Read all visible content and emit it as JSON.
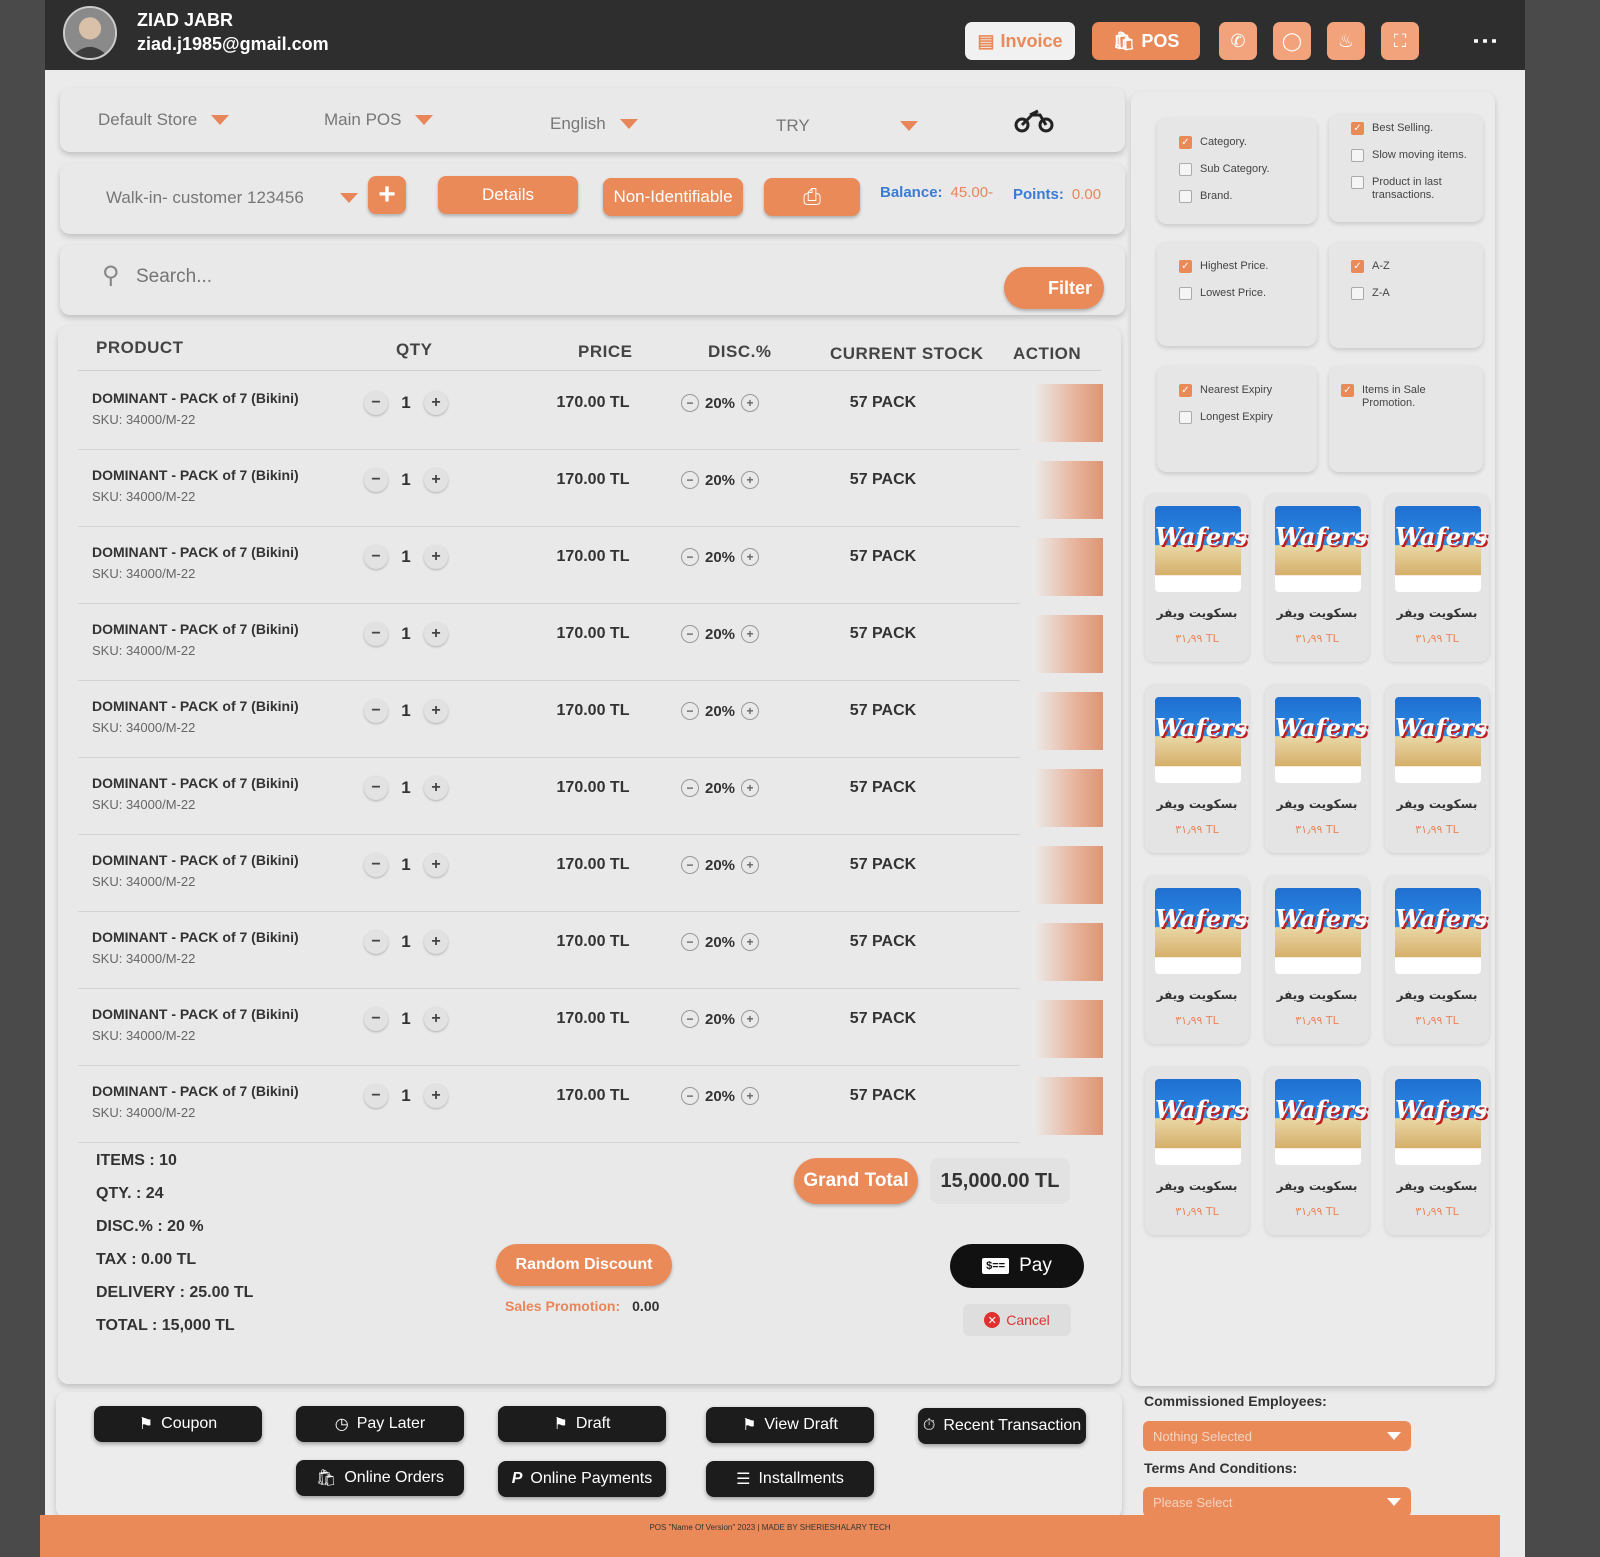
{
  "user": {
    "name": "ZIAD JABR",
    "email": "ziad.j1985@gmail.com"
  },
  "topbar": {
    "invoice_label": "Invoice",
    "pos_label": "POS",
    "icons": [
      "phone-icon",
      "globe-icon",
      "bell-icon",
      "fullscreen-icon",
      "kebab-menu-icon"
    ]
  },
  "selectors": {
    "store": "Default Store",
    "pos": "Main POS",
    "language": "English",
    "currency": "TRY"
  },
  "customer": {
    "name": "Walk-in- customer 123456",
    "details_label": "Details",
    "nonident_label": "Non-Identifiable",
    "balance_label": "Balance:",
    "balance_value": "45.00-",
    "points_label": "Points:",
    "points_value": "0.00"
  },
  "search": {
    "placeholder": "Search...",
    "filter_label": "Filter"
  },
  "table": {
    "headers": {
      "product": "PRODUCT",
      "qty": "QTY",
      "price": "PRICE",
      "disc": "DISC.%",
      "stock": "CURRENT STOCK",
      "action": "ACTION"
    },
    "rows": [
      {
        "name": "DOMINANT - PACK of 7 (Bikini)",
        "sku": "SKU: 34000/M-22",
        "qty": "1",
        "price": "170.00 TL",
        "disc": "20%",
        "stock": "57 PACK"
      },
      {
        "name": "DOMINANT - PACK of 7 (Bikini)",
        "sku": "SKU: 34000/M-22",
        "qty": "1",
        "price": "170.00 TL",
        "disc": "20%",
        "stock": "57 PACK"
      },
      {
        "name": "DOMINANT - PACK of 7 (Bikini)",
        "sku": "SKU: 34000/M-22",
        "qty": "1",
        "price": "170.00 TL",
        "disc": "20%",
        "stock": "57 PACK"
      },
      {
        "name": "DOMINANT - PACK of 7 (Bikini)",
        "sku": "SKU: 34000/M-22",
        "qty": "1",
        "price": "170.00 TL",
        "disc": "20%",
        "stock": "57 PACK"
      },
      {
        "name": "DOMINANT - PACK of 7 (Bikini)",
        "sku": "SKU: 34000/M-22",
        "qty": "1",
        "price": "170.00 TL",
        "disc": "20%",
        "stock": "57 PACK"
      },
      {
        "name": "DOMINANT - PACK of 7 (Bikini)",
        "sku": "SKU: 34000/M-22",
        "qty": "1",
        "price": "170.00 TL",
        "disc": "20%",
        "stock": "57 PACK"
      },
      {
        "name": "DOMINANT - PACK of 7 (Bikini)",
        "sku": "SKU: 34000/M-22",
        "qty": "1",
        "price": "170.00 TL",
        "disc": "20%",
        "stock": "57 PACK"
      },
      {
        "name": "DOMINANT - PACK of 7 (Bikini)",
        "sku": "SKU: 34000/M-22",
        "qty": "1",
        "price": "170.00 TL",
        "disc": "20%",
        "stock": "57 PACK"
      },
      {
        "name": "DOMINANT - PACK of 7 (Bikini)",
        "sku": "SKU: 34000/M-22",
        "qty": "1",
        "price": "170.00 TL",
        "disc": "20%",
        "stock": "57 PACK"
      },
      {
        "name": "DOMINANT - PACK of 7 (Bikini)",
        "sku": "SKU: 34000/M-22",
        "qty": "1",
        "price": "170.00 TL",
        "disc": "20%",
        "stock": "57 PACK"
      }
    ]
  },
  "summary": {
    "items": "ITEMS :  10",
    "qty": "QTY.   : 24",
    "disc": "DISC.% : 20 %",
    "tax": "TAX    : 0.00 TL",
    "delivery": "DELIVERY :  25.00 TL",
    "total": "TOTAL  :  15,000 TL"
  },
  "totals": {
    "grand_total_label": "Grand Total",
    "grand_total_value": "15,000.00 TL",
    "random_discount_label": "Random Discount",
    "sales_promotion_label": "Sales Promotion:",
    "sales_promotion_value": "0.00",
    "pay_label": "Pay",
    "cancel_label": "Cancel"
  },
  "actions": {
    "coupon": "Coupon",
    "pay_later": "Pay Later",
    "draft": "Draft",
    "view_draft": "View Draft",
    "recent_transaction": "Recent Transaction",
    "online_orders": "Online Orders",
    "online_payments": "Online Payments",
    "installments": "Installments"
  },
  "filters": {
    "group1": [
      {
        "label": "Category.",
        "checked": true
      },
      {
        "label": "Sub Category.",
        "checked": false
      },
      {
        "label": "Brand.",
        "checked": false
      }
    ],
    "group2": [
      {
        "label": "Best Selling.",
        "checked": true
      },
      {
        "label": "Slow moving items.",
        "checked": false
      },
      {
        "label": "Product in last transactions.",
        "checked": false
      }
    ],
    "group3": [
      {
        "label": "Highest Price.",
        "checked": true
      },
      {
        "label": "Lowest Price.",
        "checked": false
      }
    ],
    "group4": [
      {
        "label": "A-Z",
        "checked": true
      },
      {
        "label": "Z-A",
        "checked": false
      }
    ],
    "group5": [
      {
        "label": "Nearest Expiry",
        "checked": true
      },
      {
        "label": "Longest Expiry",
        "checked": false
      }
    ],
    "group6": [
      {
        "label": "Items in Sale Promotion.",
        "checked": true
      }
    ]
  },
  "products": {
    "image_label": "Wafers",
    "name": "بسكويت ويفر",
    "price": "٣١٫٩٩ TL",
    "count": 12
  },
  "commission": {
    "employees_label": "Commissioned Employees:",
    "employees_value": "Nothing Selected",
    "terms_label": "Terms And Conditions:",
    "terms_value": "Please Select"
  },
  "footer": {
    "text": "POS \"Name Of Version\"   2023 | MADE BY SHERIESHALARY TECH"
  },
  "colors": {
    "accent": "#ea8a59",
    "dark": "#1c1c1c",
    "topbar": "#2e2e2e"
  }
}
